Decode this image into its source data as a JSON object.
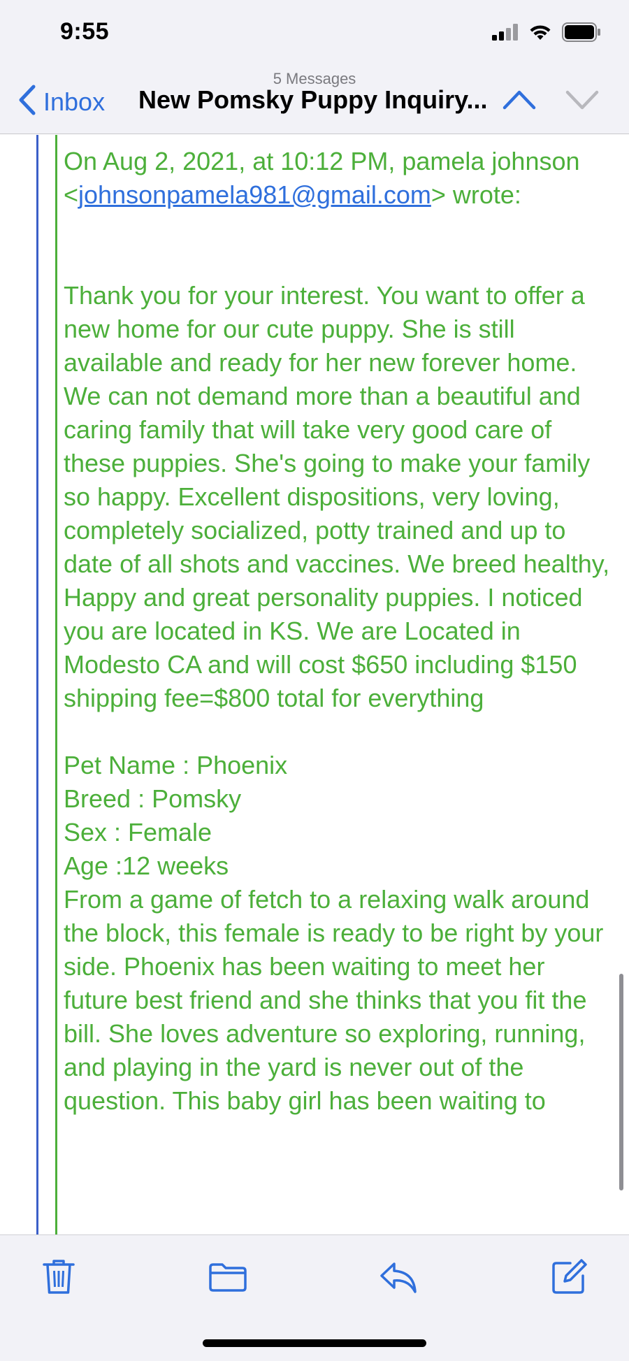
{
  "status_bar": {
    "time": "9:55",
    "icons": [
      "signal-icon",
      "wifi-icon",
      "battery-icon"
    ]
  },
  "nav": {
    "message_count": "5 Messages",
    "back_label": "Inbox",
    "title": "New Pomsky Puppy Inquiry...",
    "icons": [
      "chevron-left-icon",
      "chevron-up-icon",
      "chevron-down-icon"
    ]
  },
  "email": {
    "header_prefix": "On Aug 2, 2021, at 10:12 PM, pamela johnson",
    "header_open": "<",
    "sender_email": "johnsonpamela981@gmail.com",
    "header_close": "> wrote:",
    "paragraph1": "Thank you for your interest. You want to offer a new home for our cute puppy. She is still available and ready for her new forever home. We can not demand more than a beautiful and caring family that will take very good care of these puppies. She's going to make your family so happy. Excellent dispositions, very loving, completely socialized, potty trained and up to date of all shots and vaccines. We breed healthy, Happy and great personality puppies. I noticed you are located in KS. We are Located in Modesto CA and will cost  $650 including $150 shipping fee=$800 total for everything",
    "pet_name": "Pet Name : Phoenix",
    "breed": "Breed : Pomsky",
    "sex": "Sex : Female",
    "age": "Age :12 weeks",
    "paragraph2": "From a game of fetch to a relaxing walk around the block, this female is ready to be right by your side. Phoenix has been waiting to meet her future best friend and she thinks that you fit the bill. She loves adventure so exploring, running, and playing in the yard is never out of the question. This baby girl has been waiting to"
  },
  "colors": {
    "quote_text": "#4caf3a",
    "link": "#2f6fdc",
    "quote_bar_outer": "#3b5fc8",
    "accent": "#2f6fdc"
  },
  "toolbar": {
    "icons": [
      "trash-icon",
      "folder-icon",
      "reply-icon",
      "compose-icon"
    ]
  }
}
